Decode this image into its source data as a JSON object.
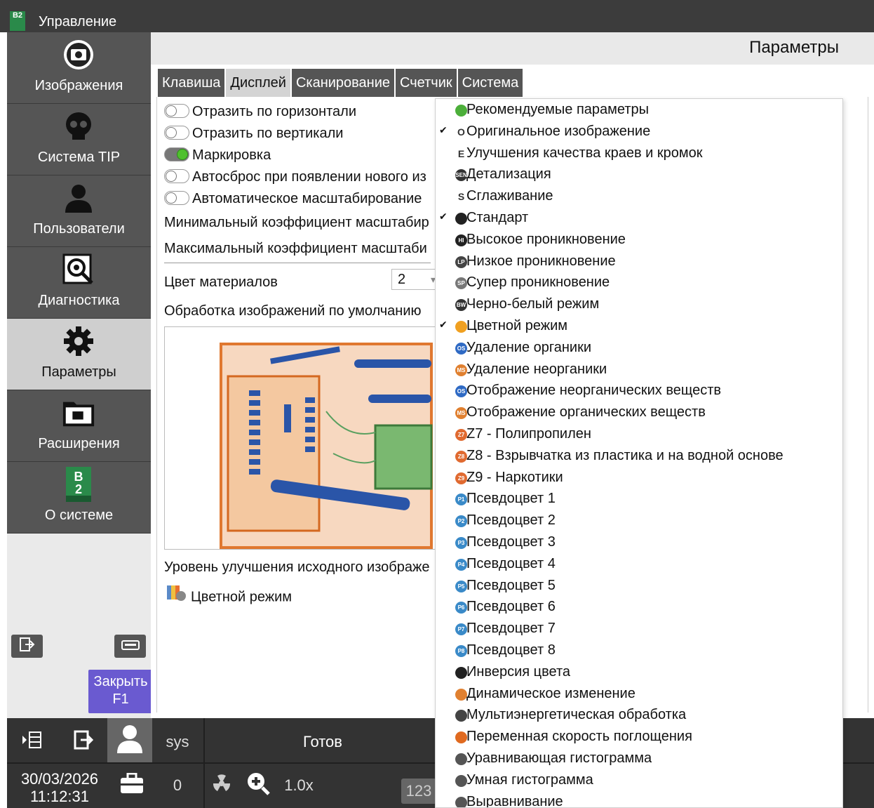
{
  "window": {
    "title": "Управление",
    "logo_text": "B2"
  },
  "sidebar": {
    "items": [
      {
        "label": "Изображения",
        "icon": "camera-icon"
      },
      {
        "label": "Система TIP",
        "icon": "skull-icon"
      },
      {
        "label": "Пользователи",
        "icon": "user-icon"
      },
      {
        "label": "Диагностика",
        "icon": "bug-search-icon"
      },
      {
        "label": "Параметры",
        "icon": "gear-icon"
      },
      {
        "label": "Расширения",
        "icon": "folder-plugin-icon"
      },
      {
        "label": "О системе",
        "icon": "b2-scan-logo-icon"
      }
    ],
    "close_label_line1": "Закрыть",
    "close_label_line2": "F1"
  },
  "main": {
    "title": "Параметры",
    "tabs": [
      "Клавиша",
      "Дисплей",
      "Сканирование",
      "Счетчик",
      "Система"
    ],
    "active_tab": "Дисплей",
    "options": [
      {
        "label": "Отразить по горизонтали",
        "on": false
      },
      {
        "label": "Отразить по вертикали",
        "on": false
      },
      {
        "label": "Маркировка",
        "on": true
      },
      {
        "label": "Автосброс при появлении нового из",
        "on": false
      },
      {
        "label": "Автоматическое масштабирование",
        "on": false
      }
    ],
    "min_zoom_label": "Минимальный коэффициент масштабир",
    "max_zoom_label": "Максимальный коэффициент масштаби",
    "material_color_label": "Цвет материалов",
    "material_color_value": "2",
    "default_processing_label": "Обработка изображений по умолчанию",
    "enhance_level_label": "Уровень улучшения исходного изображе",
    "current_mode_label": "Цветной режим"
  },
  "menu": {
    "items": [
      {
        "label": "Рекомендуемые параметры",
        "badge": "",
        "checked": false,
        "color": "#4caf3a"
      },
      {
        "label": "Оригинальное изображение",
        "badge": "O",
        "checked": true,
        "color": "#ffffff"
      },
      {
        "label": "Улучшения качества краев и кромок",
        "badge": "E",
        "checked": false,
        "color": "#ffffff"
      },
      {
        "label": "Детализация",
        "badge": "SEN",
        "checked": false,
        "color": "#333333"
      },
      {
        "label": "Сглаживание",
        "badge": "S",
        "checked": false,
        "color": "#ffffff"
      },
      {
        "label": "Стандарт",
        "badge": "",
        "checked": true,
        "color": "#222222"
      },
      {
        "label": "Высокое проникновение",
        "badge": "HI",
        "checked": false,
        "color": "#222222"
      },
      {
        "label": "Низкое проникновение",
        "badge": "LP",
        "checked": false,
        "color": "#444444"
      },
      {
        "label": "Супер проникновение",
        "badge": "SP",
        "checked": false,
        "color": "#777777"
      },
      {
        "label": "Черно-белый режим",
        "badge": "BW",
        "checked": false,
        "color": "#333333"
      },
      {
        "label": "Цветной режим",
        "badge": "",
        "checked": true,
        "color": "#f0a020"
      },
      {
        "label": "Удаление органики",
        "badge": "OS",
        "checked": false,
        "color": "#2f6ac4"
      },
      {
        "label": "Удаление неорганики",
        "badge": "MS",
        "checked": false,
        "color": "#e08030"
      },
      {
        "label": "Отображение неорганических веществ",
        "badge": "OS",
        "checked": false,
        "color": "#2f6ac4"
      },
      {
        "label": "Отображение органических веществ",
        "badge": "MS",
        "checked": false,
        "color": "#e08030"
      },
      {
        "label": "Z7 - Полипропилен",
        "badge": "Z7",
        "checked": false,
        "color": "#e06a30"
      },
      {
        "label": "Z8 - Взрывчатка из пластика и на водной основе",
        "badge": "Z8",
        "checked": false,
        "color": "#e06a30"
      },
      {
        "label": "Z9 - Наркотики",
        "badge": "Z9",
        "checked": false,
        "color": "#e06a30"
      },
      {
        "label": "Псевдоцвет 1",
        "badge": "P1",
        "checked": false,
        "color": "#3a8ac8"
      },
      {
        "label": "Псевдоцвет 2",
        "badge": "P2",
        "checked": false,
        "color": "#3a8ac8"
      },
      {
        "label": "Псевдоцвет 3",
        "badge": "P3",
        "checked": false,
        "color": "#3a8ac8"
      },
      {
        "label": "Псевдоцвет 4",
        "badge": "P4",
        "checked": false,
        "color": "#3a8ac8"
      },
      {
        "label": "Псевдоцвет 5",
        "badge": "P5",
        "checked": false,
        "color": "#3a8ac8"
      },
      {
        "label": "Псевдоцвет 6",
        "badge": "P6",
        "checked": false,
        "color": "#3a8ac8"
      },
      {
        "label": "Псевдоцвет 7",
        "badge": "P7",
        "checked": false,
        "color": "#3a8ac8"
      },
      {
        "label": "Псевдоцвет 8",
        "badge": "P8",
        "checked": false,
        "color": "#3a8ac8"
      },
      {
        "label": "Инверсия цвета",
        "badge": "",
        "checked": false,
        "color": "#222222"
      },
      {
        "label": "Динамическое изменение",
        "badge": "",
        "checked": false,
        "color": "#e08030"
      },
      {
        "label": "Мультиэнергетическая обработка",
        "badge": "",
        "checked": false,
        "color": "#444444"
      },
      {
        "label": "Переменная скорость поглощения",
        "badge": "",
        "checked": false,
        "color": "#e06a20"
      },
      {
        "label": "Уравнивающая гистограмма",
        "badge": "",
        "checked": false,
        "color": "#555555"
      },
      {
        "label": "Умная гистограмма",
        "badge": "",
        "checked": false,
        "color": "#555555"
      },
      {
        "label": "Выравнивание",
        "badge": "",
        "checked": false,
        "color": "#555555"
      }
    ]
  },
  "status": {
    "user": "sys",
    "state": "Готов",
    "date": "30/03/2026",
    "time": "11:12:31",
    "count": "0",
    "zoom": "1.0x",
    "numeric_badge": "123"
  }
}
